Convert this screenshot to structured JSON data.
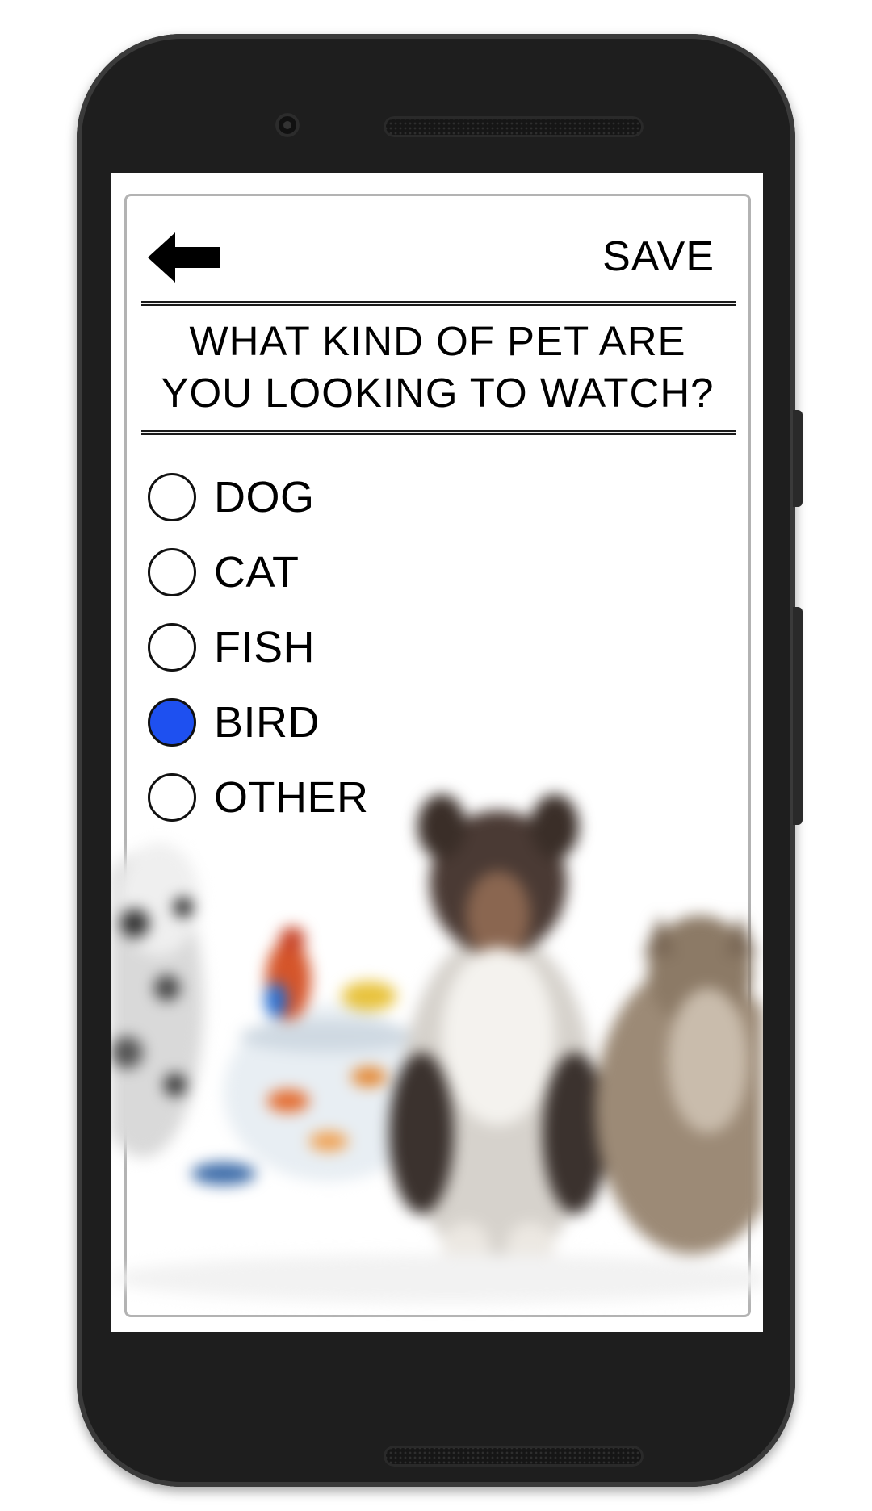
{
  "header": {
    "save_label": "SAVE"
  },
  "question": {
    "line1": "WHAT KIND OF PET ARE",
    "line2": "YOU LOOKING TO WATCH?"
  },
  "options": [
    {
      "label": "DOG",
      "selected": false
    },
    {
      "label": "CAT",
      "selected": false
    },
    {
      "label": "FISH",
      "selected": false
    },
    {
      "label": "BIRD",
      "selected": true
    },
    {
      "label": "OTHER",
      "selected": false
    }
  ],
  "colors": {
    "selected_radio": "#1e50f0",
    "phone_body": "#1e1e1e"
  },
  "icons": {
    "back": "arrow-left-icon"
  }
}
